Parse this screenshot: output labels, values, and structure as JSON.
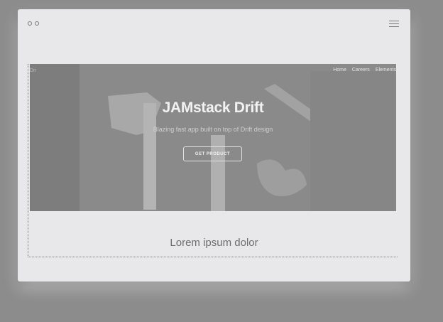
{
  "colors": {
    "backdrop": "#8c8c8c",
    "window": "#e8e8ea",
    "hero_overlay": "#8a8a8a"
  },
  "icons": {
    "window_controls": "circle-dot",
    "menu": "hamburger-icon"
  },
  "hero": {
    "brand_fragment": "Dri",
    "nav": [
      "Home",
      "Careers",
      "Elements"
    ],
    "title": "JAMstack Drift",
    "subtitle": "Blazing fast app built on top of Drift design",
    "cta": "GET PRODUCT"
  },
  "content": {
    "heading": "Lorem ipsum dolor"
  }
}
